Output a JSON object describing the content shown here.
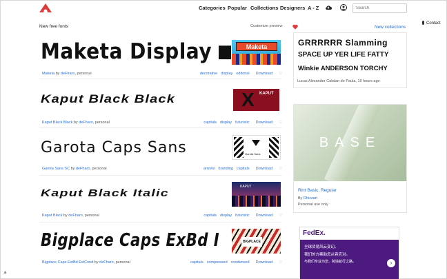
{
  "header": {
    "nav": [
      "Categories",
      "Popular",
      "Collections",
      "Designers",
      "A - Z"
    ],
    "search_placeholder": "Search",
    "contact": "Contact"
  },
  "main": {
    "title": "New free fonts",
    "customize": "Customize preview",
    "fonts": [
      {
        "sample": "Maketa Display",
        "name": "Maketa",
        "designer": "deFharo",
        "license": "personal",
        "tags": [
          "decorative",
          "display",
          "editorial"
        ],
        "thumb_text": "Maketa"
      },
      {
        "sample": "Kaput Black Black",
        "name": "Kaput Black Black",
        "designer": "deFharo",
        "license": "personal",
        "tags": [
          "capitals",
          "display",
          "futuristic"
        ],
        "thumb_text": "KAPUT"
      },
      {
        "sample": "Garota Caps Sans",
        "name": "Garota Sans SC",
        "designer": "deFharo",
        "license": "personal",
        "tags": [
          "arrows",
          "branding",
          "capitals"
        ],
        "thumb_text": "Garota Sans"
      },
      {
        "sample": "Kaput Black Italic",
        "name": "Kaput Black",
        "designer": "deFharo",
        "license": "personal",
        "tags": [
          "capitals",
          "display",
          "futuristic"
        ],
        "thumb_text": "KAPUT"
      },
      {
        "sample": "Bigplace Caps ExBd I",
        "name": "Bigplace Caps ExtBd ExtCond",
        "designer": "deFharo",
        "license": "personal",
        "tags": [
          "capitals",
          "compressed",
          "condensed"
        ],
        "thumb_text": "BIGPLACE"
      }
    ],
    "download_label": "Download",
    "by_label": "by"
  },
  "sidebar": {
    "new_collections": "New collections",
    "collection": {
      "samples": [
        "GRRRRRR Slamming",
        "SPACE UP YER LIFE FATTY",
        "Winkie ANDERSON TORCHY"
      ],
      "caption": "Lucas Alexander Catalan de Paula, 19 hours ago"
    },
    "featured": {
      "image_text": "BASE",
      "title": "Rint Basic, Regular",
      "by": "By",
      "designer": "Rhizzart",
      "license": "Personal use only"
    },
    "ad": {
      "brand": "FedEx.",
      "line1": "全球货易风云变幻。",
      "line2": "我们的方案助您从容应对。",
      "line3": "与我们专业为您、跨境航行之路。"
    }
  },
  "colors": {
    "link": "#2a6fd6",
    "heart": "#e03b3b",
    "logo": "#e03b3b",
    "ad_purple": "#4d1a7f"
  }
}
